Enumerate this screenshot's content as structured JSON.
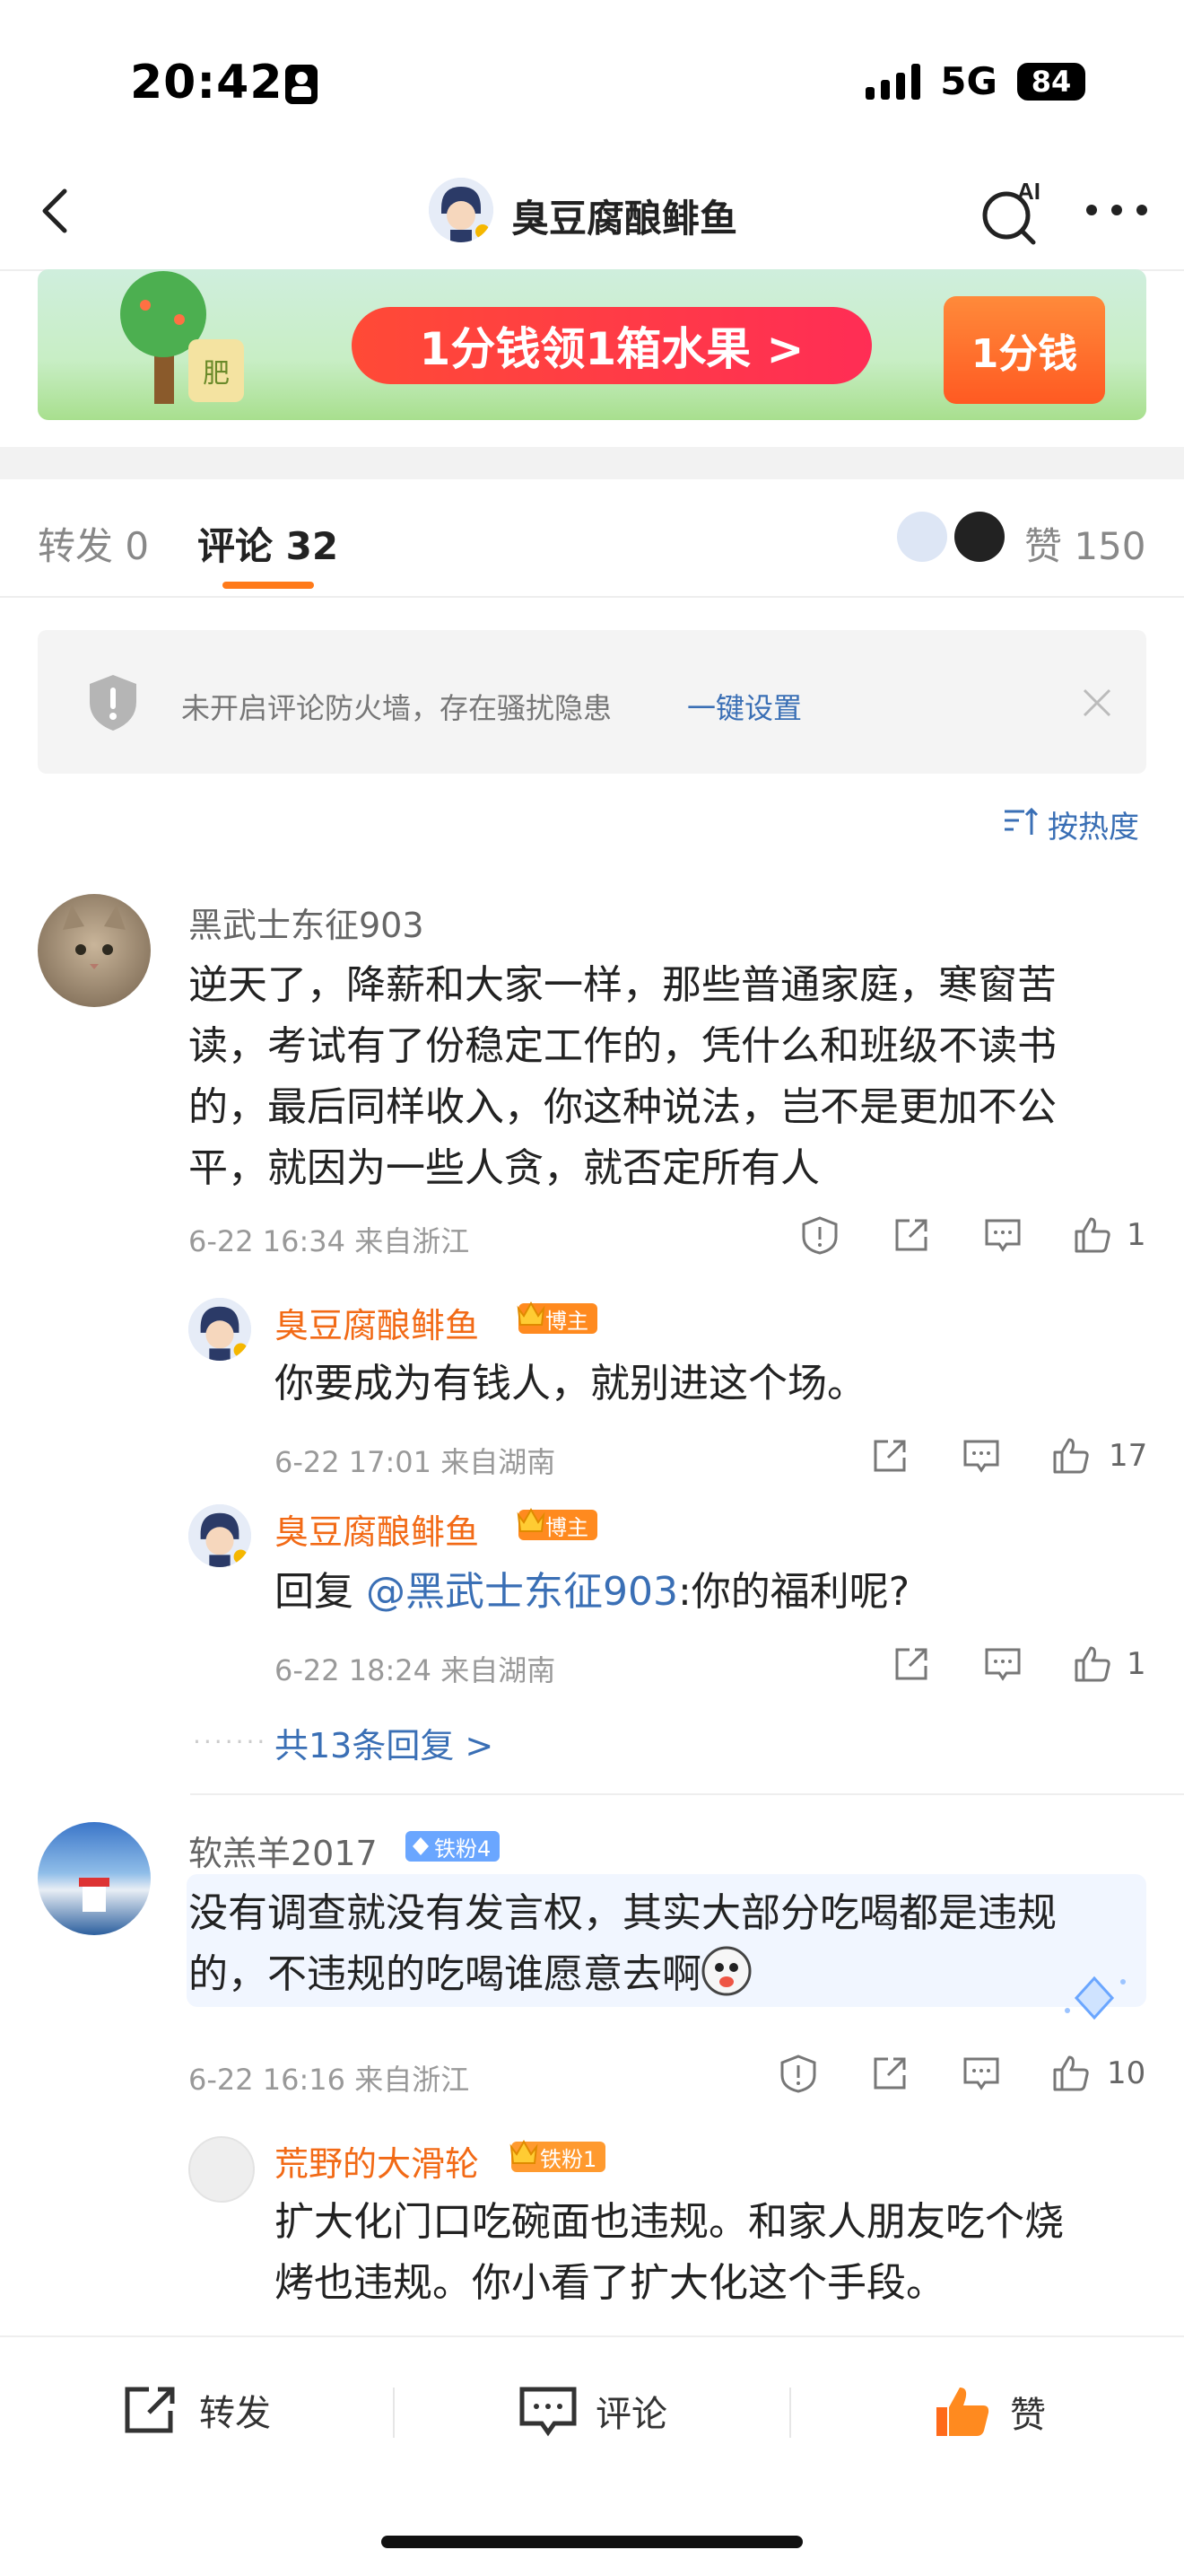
{
  "status": {
    "time": "20:42",
    "network": "5G",
    "battery": "84"
  },
  "nav": {
    "title": "臭豆腐酿鲱鱼",
    "ai_label": "AI"
  },
  "banner": {
    "cta": "1分钱领1箱水果 >",
    "box_label": "1分钱",
    "tree_tag": "肥"
  },
  "tabs": {
    "repost": "转发 0",
    "comments": "评论 32",
    "likes": "赞 150"
  },
  "firewall": {
    "text": "未开启评论防火墙，存在骚扰隐患",
    "link": "一键设置"
  },
  "sort": {
    "label": "按热度"
  },
  "comments": [
    {
      "user": "黑武士东征903",
      "lines": [
        "逆天了，降薪和大家一样，那些普通家庭，寒窗苦",
        "读，考试有了份稳定工作的，凭什么和班级不读书",
        "的，最后同样收入，你这种说法，岂不是更加不公",
        "平，就因为一些人贪，就否定所有人"
      ],
      "meta": "6-22 16:34  来自浙江",
      "likes": "1",
      "replies": [
        {
          "user": "臭豆腐酿鲱鱼",
          "badge": "博主",
          "text": "你要成为有钱人，就别进这个场。",
          "meta": "6-22 17:01  来自湖南",
          "likes": "17"
        },
        {
          "user": "臭豆腐酿鲱鱼",
          "badge": "博主",
          "reply_prefix": "回复 ",
          "mention": "@黑武士东征903",
          "text": ":你的福利呢?",
          "meta": "6-22 18:24  来自湖南",
          "likes": "1"
        }
      ],
      "more_replies": "共13条回复 >"
    },
    {
      "user": "软羔羊2017",
      "badge": "铁粉4",
      "lines": [
        "没有调查就没有发言权，其实大部分吃喝都是违规",
        "的，不违规的吃喝谁愿意去啊"
      ],
      "meta": "6-22 16:16  来自浙江",
      "likes": "10",
      "replies": [
        {
          "user": "荒野的大滑轮",
          "badge": "铁粉1",
          "lines": [
            "扩大化门口吃碗面也违规。和家人朋友吃个烧",
            "烤也违规。你小看了扩大化这个手段。"
          ]
        }
      ]
    }
  ],
  "bottom_bar": {
    "repost": "转发",
    "comment": "评论",
    "like": "赞"
  },
  "colors": {
    "accent": "#ff7a1a",
    "link": "#3a6fb5",
    "host_name": "#f26a16"
  }
}
